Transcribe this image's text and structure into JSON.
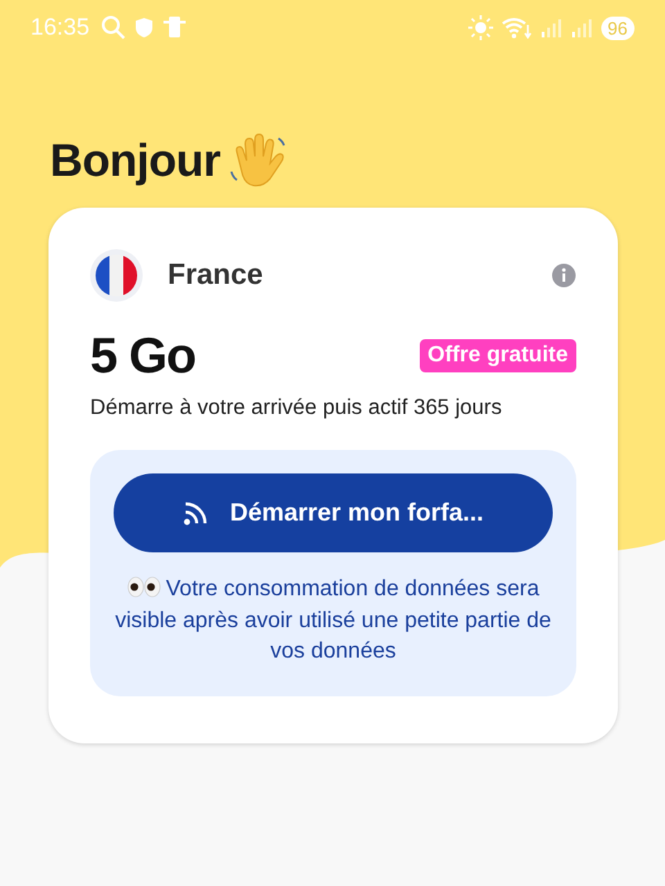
{
  "status_bar": {
    "time": "16:35",
    "battery": "96"
  },
  "greeting": "Bonjour",
  "plan": {
    "country": "France",
    "amount": "5 Go",
    "badge": "Offre gratuite",
    "description": "Démarre à votre arrivée puis actif 365 jours",
    "button": "Démarrer mon forfa...",
    "note": "Votre consommation de données sera visible après avoir utilisé une petite partie de vos données"
  }
}
